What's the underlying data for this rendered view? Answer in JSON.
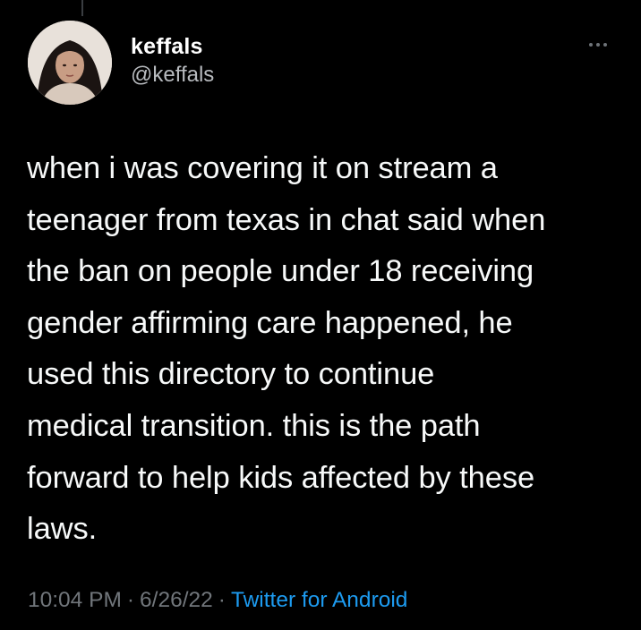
{
  "author": {
    "display_name": "keffals",
    "handle": "@keffals",
    "avatar_icon": "profile-photo"
  },
  "menu": {
    "icon": "more-horizontal-icon"
  },
  "tweet": {
    "lines": [
      "when i was covering it on stream a",
      "teenager from texas in chat said when",
      "the ban on people under 18 receiving",
      "gender affirming care happened, he",
      "used this directory to continue",
      "medical transition. this is the path",
      "forward to help kids affected by these",
      "laws."
    ]
  },
  "meta": {
    "time": "10:04 PM",
    "separator": "·",
    "date": "6/26/22",
    "source": "Twitter for Android"
  },
  "colors": {
    "background": "#000000",
    "text": "#f7f9f9",
    "secondary": "#71767b",
    "link": "#1d9bf0"
  }
}
